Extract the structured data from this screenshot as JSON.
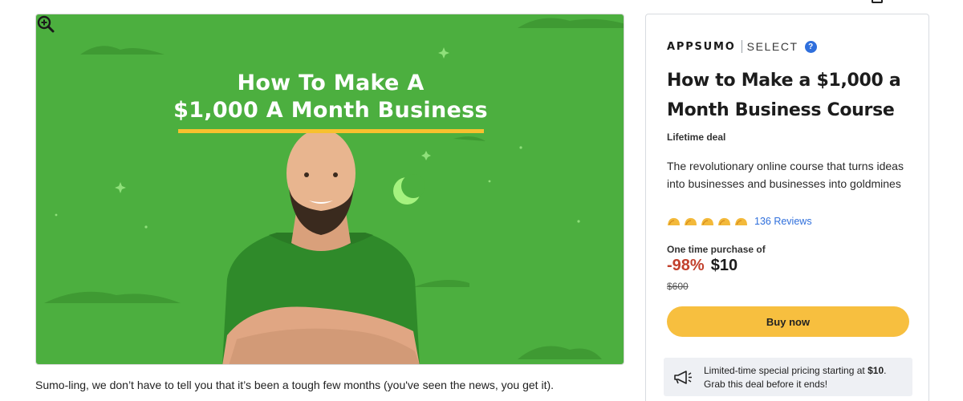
{
  "hero": {
    "title_line1": "How To Make A",
    "title_line2": "$1,000 A Month Business",
    "background_color": "#4caf3f",
    "underline_color": "#f7c12e",
    "zoom_icon": "zoom-in-icon"
  },
  "caption": "Sumo-ling, we don’t have to tell you that it’s been a tough few months (you've seen the news, you get it).",
  "product": {
    "brand_name": "APPSUMO",
    "brand_tier": "SELECT",
    "help_icon_label": "?",
    "title": "How to Make a $1,000 a Month Business Course",
    "deal_type": "Lifetime deal",
    "description": "The revolutionary online course that turns ideas into businesses and businesses into goldmines",
    "rating_icon": "taco-icon",
    "rating_count": 5,
    "reviews_label": "136 Reviews",
    "purchase_label": "One time purchase of",
    "discount": "-98%",
    "price": "$10",
    "original_price": "$600",
    "buy_label": "Buy now",
    "promo_text_before": "Limited-time special pricing starting at ",
    "promo_price": "$10",
    "promo_text_after": ".",
    "promo_line2": "Grab this deal before it ends!",
    "promo_icon": "megaphone-icon"
  },
  "colors": {
    "accent_yellow": "#f7bf3f",
    "discount_red": "#c2412d",
    "link_blue": "#2f6fdc"
  }
}
